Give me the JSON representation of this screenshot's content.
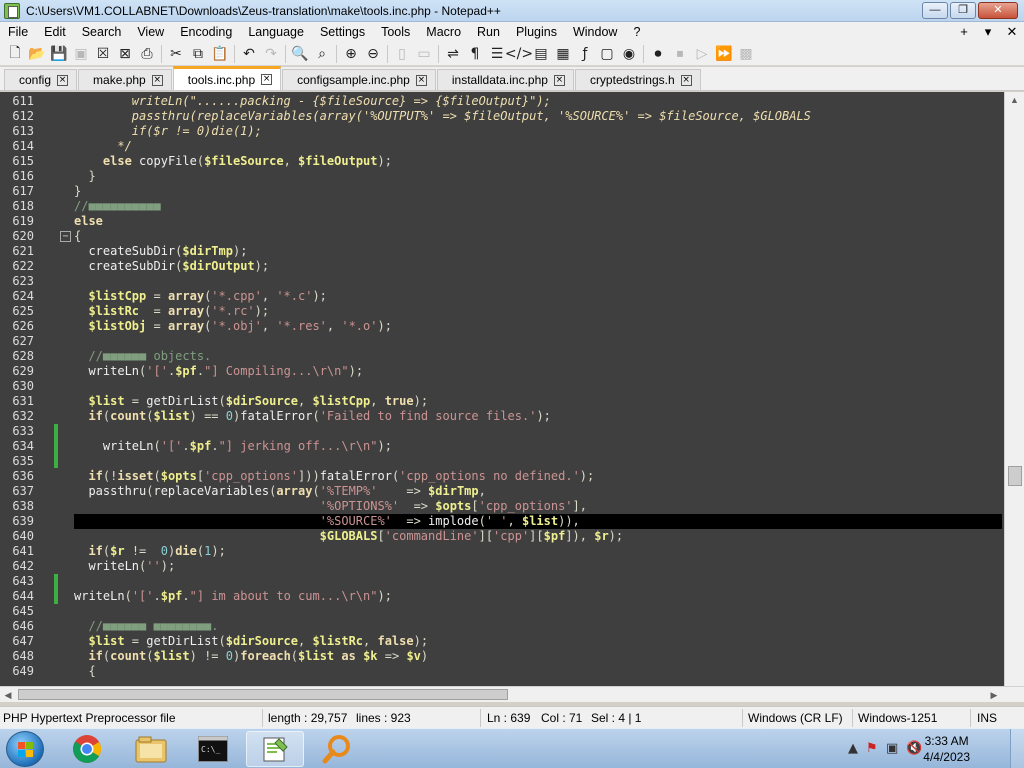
{
  "window": {
    "title": "C:\\Users\\VM1.COLLABNET\\Downloads\\Zeus-translation\\make\\tools.inc.php - Notepad++",
    "btn_minimize": "—",
    "btn_maximize": "❐",
    "btn_close": "✕"
  },
  "menu": {
    "items": [
      "File",
      "Edit",
      "Search",
      "View",
      "Encoding",
      "Language",
      "Settings",
      "Tools",
      "Macro",
      "Run",
      "Plugins",
      "Window",
      "?"
    ],
    "right_plus": "+",
    "right_down": "▾",
    "right_close": "✕"
  },
  "tabs": [
    {
      "label": "config",
      "active": false
    },
    {
      "label": "make.php",
      "active": false
    },
    {
      "label": "tools.inc.php",
      "active": true
    },
    {
      "label": "configsample.inc.php",
      "active": false
    },
    {
      "label": "installdata.inc.php",
      "active": false
    },
    {
      "label": "cryptedstrings.h",
      "active": false
    }
  ],
  "editor": {
    "line_numbers": [
      "611",
      "612",
      "613",
      "614",
      "615",
      "616",
      "617",
      "618",
      "619",
      "620",
      "621",
      "622",
      "623",
      "624",
      "625",
      "626",
      "627",
      "628",
      "629",
      "630",
      "631",
      "632",
      "633",
      "634",
      "635",
      "636",
      "637",
      "638",
      "639",
      "640",
      "641",
      "642",
      "643",
      "644",
      "645",
      "646",
      "647",
      "648",
      "649"
    ],
    "lines": [
      "        writeLn(\"......packing - {$fileSource} => {$fileOutput}\");",
      "        passthru(replaceVariables(array('%OUTPUT%' => $fileOutput, '%SOURCE%' => $fileSource, $GLOBALS",
      "        if($r != 0)die(1);",
      "      */",
      "    else copyFile($fileSource, $fileOutput);",
      "  }",
      "}",
      "//■■■■■■■■■■",
      "else",
      "{",
      "  createSubDir($dirTmp);",
      "  createSubDir($dirOutput);",
      "",
      "  $listCpp = array('*.cpp', '*.c');",
      "  $listRc  = array('*.rc');",
      "  $listObj = array('*.obj', '*.res', '*.o');",
      "",
      "  //■■■■■■ objects.",
      "  writeLn('['.$pf.\"] Compiling...\\r\\n\");",
      "",
      "  $list = getDirList($dirSource, $listCpp, true);",
      "  if(count($list) == 0)fatalError('Failed to find source files.');",
      "",
      "    writeLn('['.$pf.\"] jerking off...\\r\\n\");",
      "",
      "  if(!isset($opts['cpp_options']))fatalError('cpp_options no defined.');",
      "  passthru(replaceVariables(array('%TEMP%'    => $dirTmp,",
      "                                  '%OPTIONS%'  => $opts['cpp_options'],",
      "                                  '%SOURCE%'  => implode(' ', $list)),",
      "                                  $GLOBALS['commandLine']['cpp'][$pf]), $r);",
      "  if($r !=  0)die(1);",
      "  writeLn('');",
      "",
      "writeLn('['.$pf.\"] im about to cum...\\r\\n\");",
      "",
      "  //■■■■■■ ■■■■■■■■.",
      "  $list = getDirList($dirSource, $listRc, false);",
      "  if(count($list) != 0)foreach($list as $k => $v)",
      "  {"
    ],
    "current_line": "639"
  },
  "status": {
    "filetype": "PHP Hypertext Preprocessor file",
    "length": "length : 29,757",
    "lines": "lines : 923",
    "ln": "Ln : 639",
    "col": "Col : 71",
    "sel": "Sel : 4 | 1",
    "eol": "Windows (CR LF)",
    "encoding": "Windows-1251",
    "mode": "INS"
  },
  "taskbar": {
    "time": "3:33 AM",
    "date": "4/4/2023"
  },
  "colors": {
    "editor_bg": "#3f3f3f",
    "active_tab_accent": "#f5a623",
    "change_marker": "#3cb043"
  }
}
